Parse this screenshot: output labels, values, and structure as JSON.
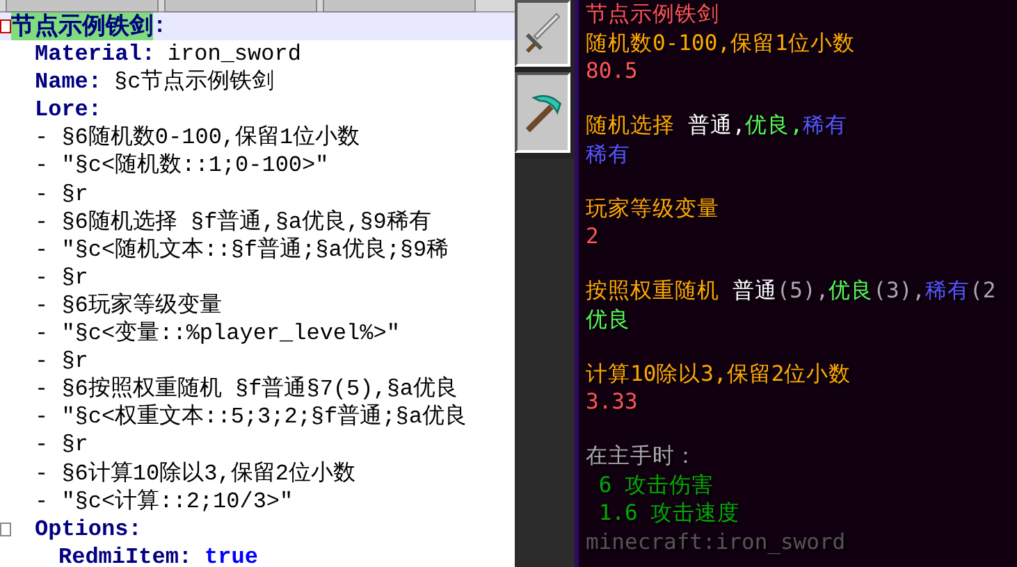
{
  "editor": {
    "root": {
      "key": "节点示例铁剑",
      "suffix": ":",
      "selected": true,
      "expanded": true,
      "children": [
        {
          "kind": "pair",
          "key": "Material:",
          "value": "iron_sword"
        },
        {
          "kind": "pair",
          "key": "Name:",
          "value": "§c节点示例铁剑"
        },
        {
          "kind": "pair",
          "key": "Lore:"
        },
        {
          "kind": "item",
          "text": "- §6随机数0-100,保留1位小数"
        },
        {
          "kind": "item",
          "text": "- \"§c<随机数::1;0-100>\""
        },
        {
          "kind": "item",
          "text": "- §r"
        },
        {
          "kind": "item",
          "text": "- §6随机选择 §f普通,§a优良,§9稀有"
        },
        {
          "kind": "item",
          "text": "- \"§c<随机文本::§f普通;§a优良;§9稀"
        },
        {
          "kind": "item",
          "text": "- §r"
        },
        {
          "kind": "item",
          "text": "- §6玩家等级变量"
        },
        {
          "kind": "item",
          "text": "- \"§c<变量::%player_level%>\""
        },
        {
          "kind": "item",
          "text": "- §r"
        },
        {
          "kind": "item",
          "text": "- §6按照权重随机 §f普通§7(5),§a优良"
        },
        {
          "kind": "item",
          "text": "- \"§c<权重文本::5;3;2;§f普通;§a优良"
        },
        {
          "kind": "item",
          "text": "- §r"
        },
        {
          "kind": "item",
          "text": "- §6计算10除以3,保留2位小数"
        },
        {
          "kind": "item",
          "text": "- \"§c<计算::2;10/3>\""
        },
        {
          "kind": "pair",
          "key": "Options:",
          "expanded": true,
          "children": [
            {
              "kind": "keyword-pair",
              "key": "RedmiItem:",
              "value": "true"
            }
          ]
        }
      ]
    }
  },
  "tooltip": {
    "blocks": [
      {
        "lines": [
          {
            "segments": [
              {
                "text": "节点示例铁剑",
                "color": "#ff5555"
              }
            ]
          },
          {
            "segments": [
              {
                "text": "随机数0-100,保留1位小数",
                "color": "#ffaa00"
              }
            ]
          },
          {
            "segments": [
              {
                "text": "80.5",
                "color": "#ff5555"
              }
            ]
          }
        ]
      },
      {
        "lines": [
          {
            "segments": [
              {
                "text": "随机选择 ",
                "color": "#ffaa00"
              },
              {
                "text": "普通,",
                "color": "#ffffff"
              },
              {
                "text": "优良,",
                "color": "#55ff55"
              },
              {
                "text": "稀有",
                "color": "#5555ff"
              }
            ]
          },
          {
            "segments": [
              {
                "text": "稀有",
                "color": "#5555ff"
              }
            ]
          }
        ]
      },
      {
        "lines": [
          {
            "segments": [
              {
                "text": "玩家等级变量",
                "color": "#ffaa00"
              }
            ]
          },
          {
            "segments": [
              {
                "text": "2",
                "color": "#ff5555"
              }
            ]
          }
        ]
      },
      {
        "lines": [
          {
            "segments": [
              {
                "text": "按照权重随机 ",
                "color": "#ffaa00"
              },
              {
                "text": "普通",
                "color": "#ffffff"
              },
              {
                "text": "(5),",
                "color": "#aaaaaa"
              },
              {
                "text": "优良",
                "color": "#55ff55"
              },
              {
                "text": "(3),",
                "color": "#aaaaaa"
              },
              {
                "text": "稀有",
                "color": "#5555ff"
              },
              {
                "text": "(2",
                "color": "#aaaaaa"
              }
            ]
          },
          {
            "segments": [
              {
                "text": "优良",
                "color": "#55ff55"
              }
            ]
          }
        ]
      },
      {
        "lines": [
          {
            "segments": [
              {
                "text": "计算10除以3,保留2位小数",
                "color": "#ffaa00"
              }
            ]
          },
          {
            "segments": [
              {
                "text": "3.33",
                "color": "#ff5555"
              }
            ]
          }
        ]
      },
      {
        "lines": [
          {
            "segments": [
              {
                "text": "在主手时：",
                "color": "#aaaaaa"
              }
            ]
          },
          {
            "segments": [
              {
                "text": " 6 攻击伤害",
                "color": "#00aa00"
              }
            ]
          },
          {
            "segments": [
              {
                "text": " 1.6 攻击速度",
                "color": "#00aa00"
              }
            ]
          },
          {
            "segments": [
              {
                "text": "minecraft:iron_sword",
                "color": "#555555"
              }
            ]
          }
        ]
      }
    ]
  }
}
